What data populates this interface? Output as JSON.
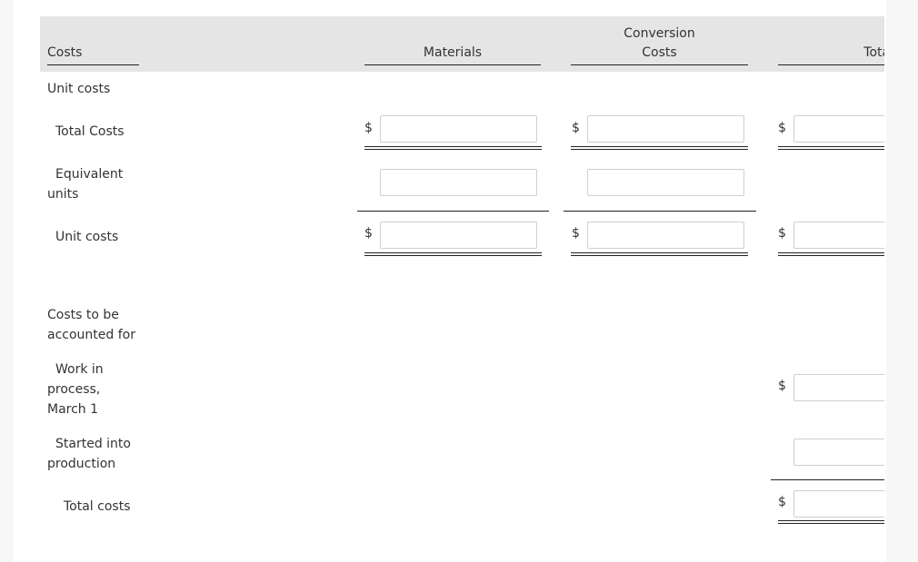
{
  "header": {
    "col_costs": "Costs",
    "col_materials": "Materials",
    "col_conversion_line1": "Conversion",
    "col_conversion_line2": "Costs",
    "col_total": "Total"
  },
  "rows": {
    "unit_costs_heading": "Unit costs",
    "total_costs": "Total Costs",
    "equivalent_units_line1": "Equivalent",
    "equivalent_units_line2": "units",
    "unit_costs": "Unit costs",
    "costs_to_be_line1": "Costs to be",
    "costs_to_be_line2": "accounted for",
    "wip_line1": "Work in",
    "wip_line2": "process,",
    "wip_line3": "March 1",
    "started_line1": "Started into",
    "started_line2": "production",
    "total_costs_final": "Total costs"
  },
  "currency_symbol": "$",
  "inputs": {
    "total_costs_materials": "",
    "total_costs_conversion": "",
    "total_costs_total": "",
    "equiv_units_materials": "",
    "equiv_units_conversion": "",
    "unit_costs_materials": "",
    "unit_costs_conversion": "",
    "unit_costs_total": "",
    "wip_march1_total": "",
    "started_into_production_total": "",
    "total_costs_final_total": ""
  }
}
